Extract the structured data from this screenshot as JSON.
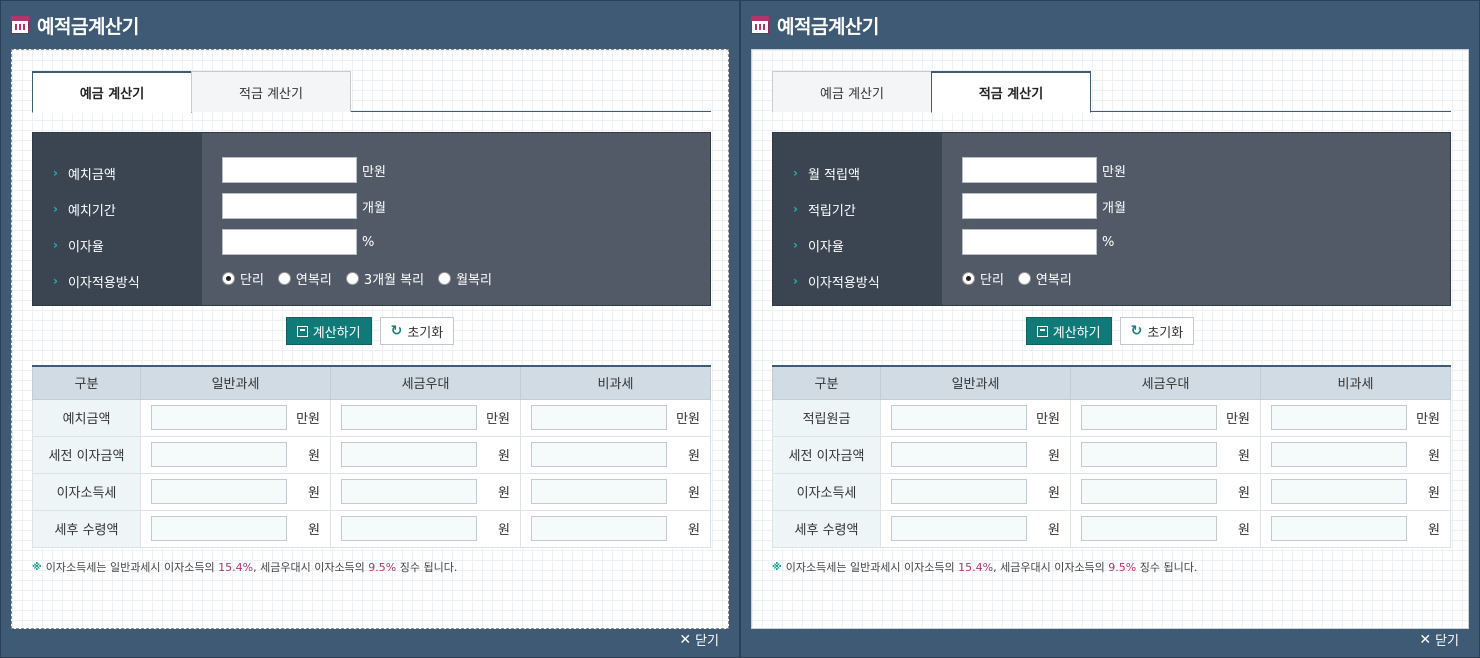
{
  "windows": [
    {
      "title": "예적금계산기",
      "active_tab": 0,
      "tabs": [
        "예금 계산기",
        "적금 계산기"
      ],
      "fields": [
        {
          "label": "예치금액",
          "unit": "만원",
          "value": ""
        },
        {
          "label": "예치기간",
          "unit": "개월",
          "value": ""
        },
        {
          "label": "이자율",
          "unit": "%",
          "value": ""
        }
      ],
      "method_label": "이자적용방식",
      "radios": [
        {
          "label": "단리",
          "checked": true
        },
        {
          "label": "연복리",
          "checked": false
        },
        {
          "label": "3개월 복리",
          "checked": false
        },
        {
          "label": "월복리",
          "checked": false
        }
      ],
      "calc_label": "계산하기",
      "reset_label": "초기화",
      "table": {
        "headers": [
          "구분",
          "일반과세",
          "세금우대",
          "비과세"
        ],
        "rows": [
          {
            "label": "예치금액",
            "unit": "만원"
          },
          {
            "label": "세전 이자금액",
            "unit": "원"
          },
          {
            "label": "이자소득세",
            "unit": "원"
          },
          {
            "label": "세후 수령액",
            "unit": "원"
          }
        ]
      },
      "note": {
        "mark": "※",
        "p1": "이자소득세는 일반과세시 이자소득의 ",
        "v1": "15.4%",
        "p2": ", 세금우대시 이자소득의 ",
        "v2": "9.5%",
        "p3": " 징수 됩니다."
      },
      "close_label": "닫기"
    },
    {
      "title": "예적금계산기",
      "active_tab": 1,
      "tabs": [
        "예금 계산기",
        "적금 계산기"
      ],
      "fields": [
        {
          "label": "월 적립액",
          "unit": "만원",
          "value": ""
        },
        {
          "label": "적립기간",
          "unit": "개월",
          "value": ""
        },
        {
          "label": "이자율",
          "unit": "%",
          "value": ""
        }
      ],
      "method_label": "이자적용방식",
      "radios": [
        {
          "label": "단리",
          "checked": true
        },
        {
          "label": "연복리",
          "checked": false
        }
      ],
      "calc_label": "계산하기",
      "reset_label": "초기화",
      "table": {
        "headers": [
          "구분",
          "일반과세",
          "세금우대",
          "비과세"
        ],
        "rows": [
          {
            "label": "적립원금",
            "unit": "만원"
          },
          {
            "label": "세전 이자금액",
            "unit": "원"
          },
          {
            "label": "이자소득세",
            "unit": "원"
          },
          {
            "label": "세후 수령액",
            "unit": "원"
          }
        ]
      },
      "note": {
        "mark": "※",
        "p1": "이자소득세는 일반과세시 이자소득의 ",
        "v1": "15.4%",
        "p2": ", 세금우대시 이자소득의 ",
        "v2": "9.5%",
        "p3": " 징수 됩니다."
      },
      "close_label": "닫기"
    }
  ],
  "colors": {
    "frame": "#3e5a75",
    "accent_button": "#0f7a78",
    "highlight": "#b0356a",
    "chevron": "#2ab0a9"
  }
}
